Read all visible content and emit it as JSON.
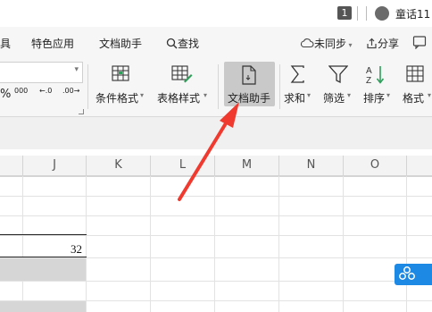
{
  "titlebar": {
    "badge": "1",
    "account_name": "童话11"
  },
  "menubar": {
    "cut_label": "具",
    "items": [
      "特色应用",
      "文档助手",
      "查找"
    ],
    "sync_label": "未同步",
    "share_label": "分享"
  },
  "ribbon": {
    "number_symbols": [
      "%",
      "000",
      "←.0",
      ".00→"
    ],
    "buttons": {
      "conditional_format": "条件格式",
      "table_style": "表格样式",
      "doc_assistant": "文档助手",
      "sum": "求和",
      "filter": "筛选",
      "sort": "排序",
      "format": "格式"
    }
  },
  "grid": {
    "columns": [
      "J",
      "K",
      "L",
      "M",
      "N",
      "O"
    ],
    "cell_value": "32"
  },
  "colors": {
    "arrow": "#f03a2f",
    "highlight": "#c9c9c9",
    "accent": "#1e88e5"
  }
}
